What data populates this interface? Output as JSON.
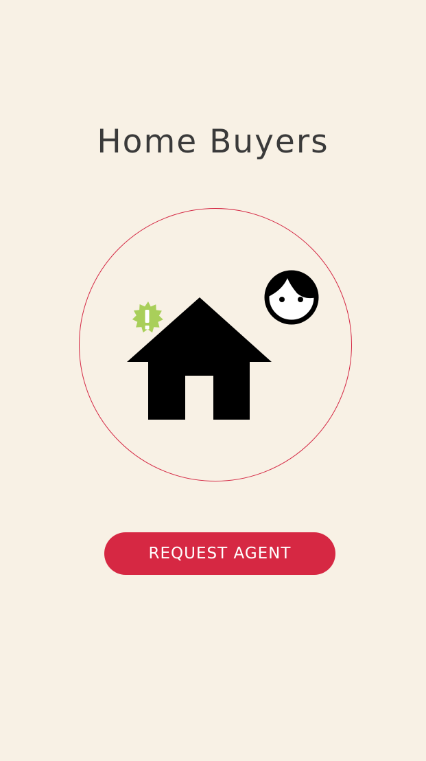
{
  "header": {
    "title": "Home Buyers"
  },
  "hero": {
    "house_icon": "house-icon",
    "alert_icon": "exclamation-badge-icon",
    "person_icon": "face-icon",
    "circle_color": "#d42743",
    "badge_color": "#a9cf5a"
  },
  "actions": {
    "request_agent_label": "REQUEST AGENT"
  },
  "theme": {
    "background": "#f8f1e5",
    "accent": "#d62843"
  }
}
